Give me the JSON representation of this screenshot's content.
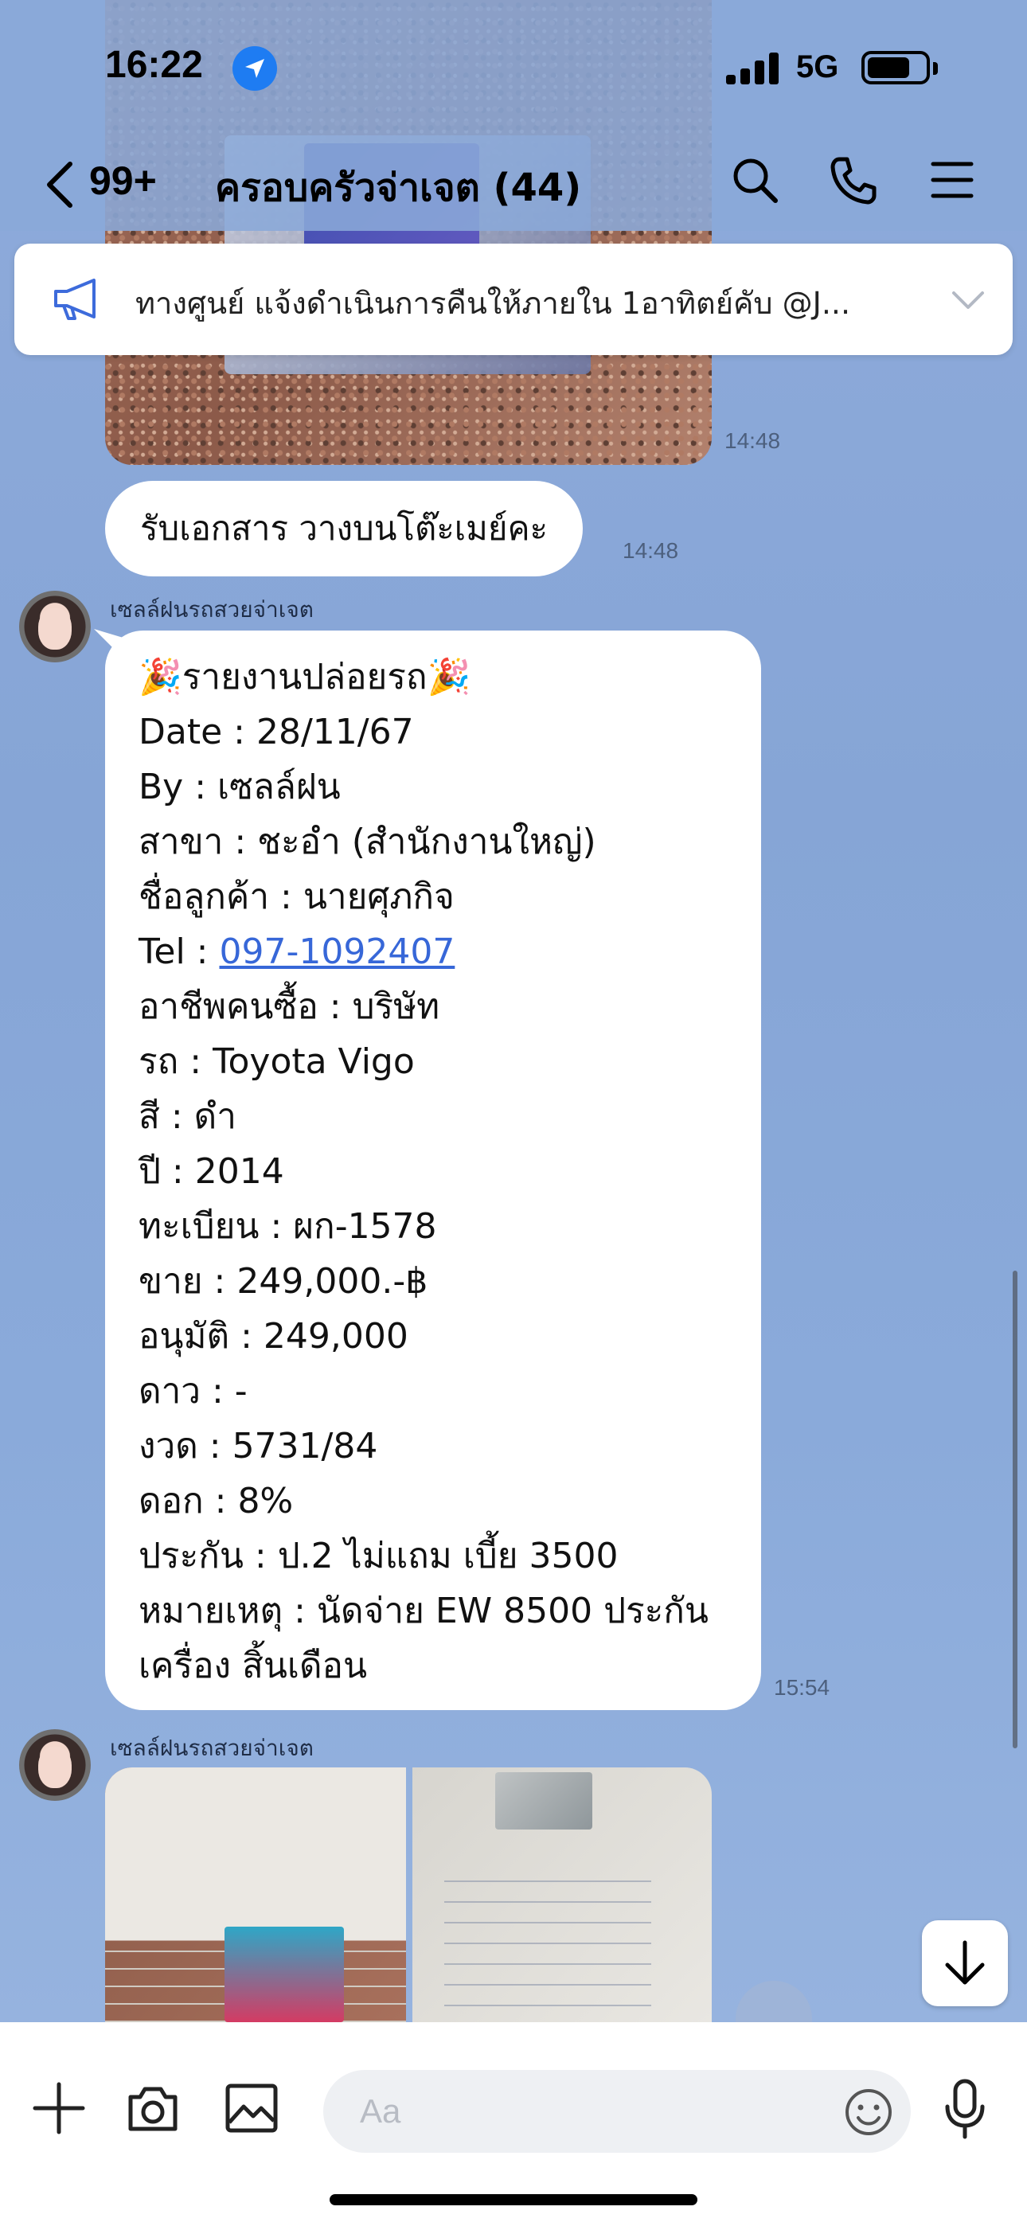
{
  "status_bar": {
    "time": "16:22",
    "network": "5G"
  },
  "header": {
    "back_count": "99+",
    "title": "ครอบครัวจ่าเจต (44)"
  },
  "announcement": {
    "text": "ทางศูนย์ แจ้งดำเนินการคืนให้ภายใน 1อาทิตย์คับ @J..."
  },
  "messages": {
    "photo_top_time": "14:48",
    "short_text": "รับเอกสาร วางบนโต๊ะเมย์คะ",
    "short_time": "14:48",
    "report": {
      "sender": "เซลล์ฝนรถสวยจ่าเจต",
      "title": "🎉รายงานปล่อยรถ🎉",
      "lines": [
        {
          "label": "Date : ",
          "value": "28/11/67"
        },
        {
          "label": "By : ",
          "value": "เซลล์ฝน"
        },
        {
          "label": "สาขา : ",
          "value": "ชะอำ (สำนักงานใหญ่)"
        },
        {
          "label": "ชื่อลูกค้า : ",
          "value": "นายศุภกิจ"
        },
        {
          "label": "Tel : ",
          "value": "097-1092407"
        },
        {
          "label": "อาชีพคนซื้อ : ",
          "value": "บริษัท"
        },
        {
          "label": "รถ : ",
          "value": "Toyota Vigo"
        },
        {
          "label": "สี : ",
          "value": "ดำ"
        },
        {
          "label": "ปี : ",
          "value": "2014"
        },
        {
          "label": "ทะเบียน : ",
          "value": "ผก-1578"
        },
        {
          "label": "ขาย : ",
          "value": "249,000.-฿"
        },
        {
          "label": "อนุมัติ : ",
          "value": "249,000"
        },
        {
          "label": "ดาว : ",
          "value": "-"
        },
        {
          "label": "งวด : ",
          "value": "5731/84"
        },
        {
          "label": "ดอก : ",
          "value": "8%"
        },
        {
          "label": "ประกัน : ",
          "value": "ป.2 ไม่แถม เบี้ย 3500"
        },
        {
          "label": "หมายเหตุ : ",
          "value": "นัดจ่าย EW 8500 ประกัน"
        },
        {
          "label": "",
          "value": "เครื่อง สิ้นเดือน"
        }
      ],
      "time": "15:54"
    },
    "photos_sender": "เซลล์ฝนรถสวยจ่าเจต"
  },
  "composer": {
    "placeholder": "Aa"
  },
  "colors": {
    "accent": "#1e7cf2",
    "link": "#3767d8",
    "chat_bg": "#8aa9d8"
  }
}
